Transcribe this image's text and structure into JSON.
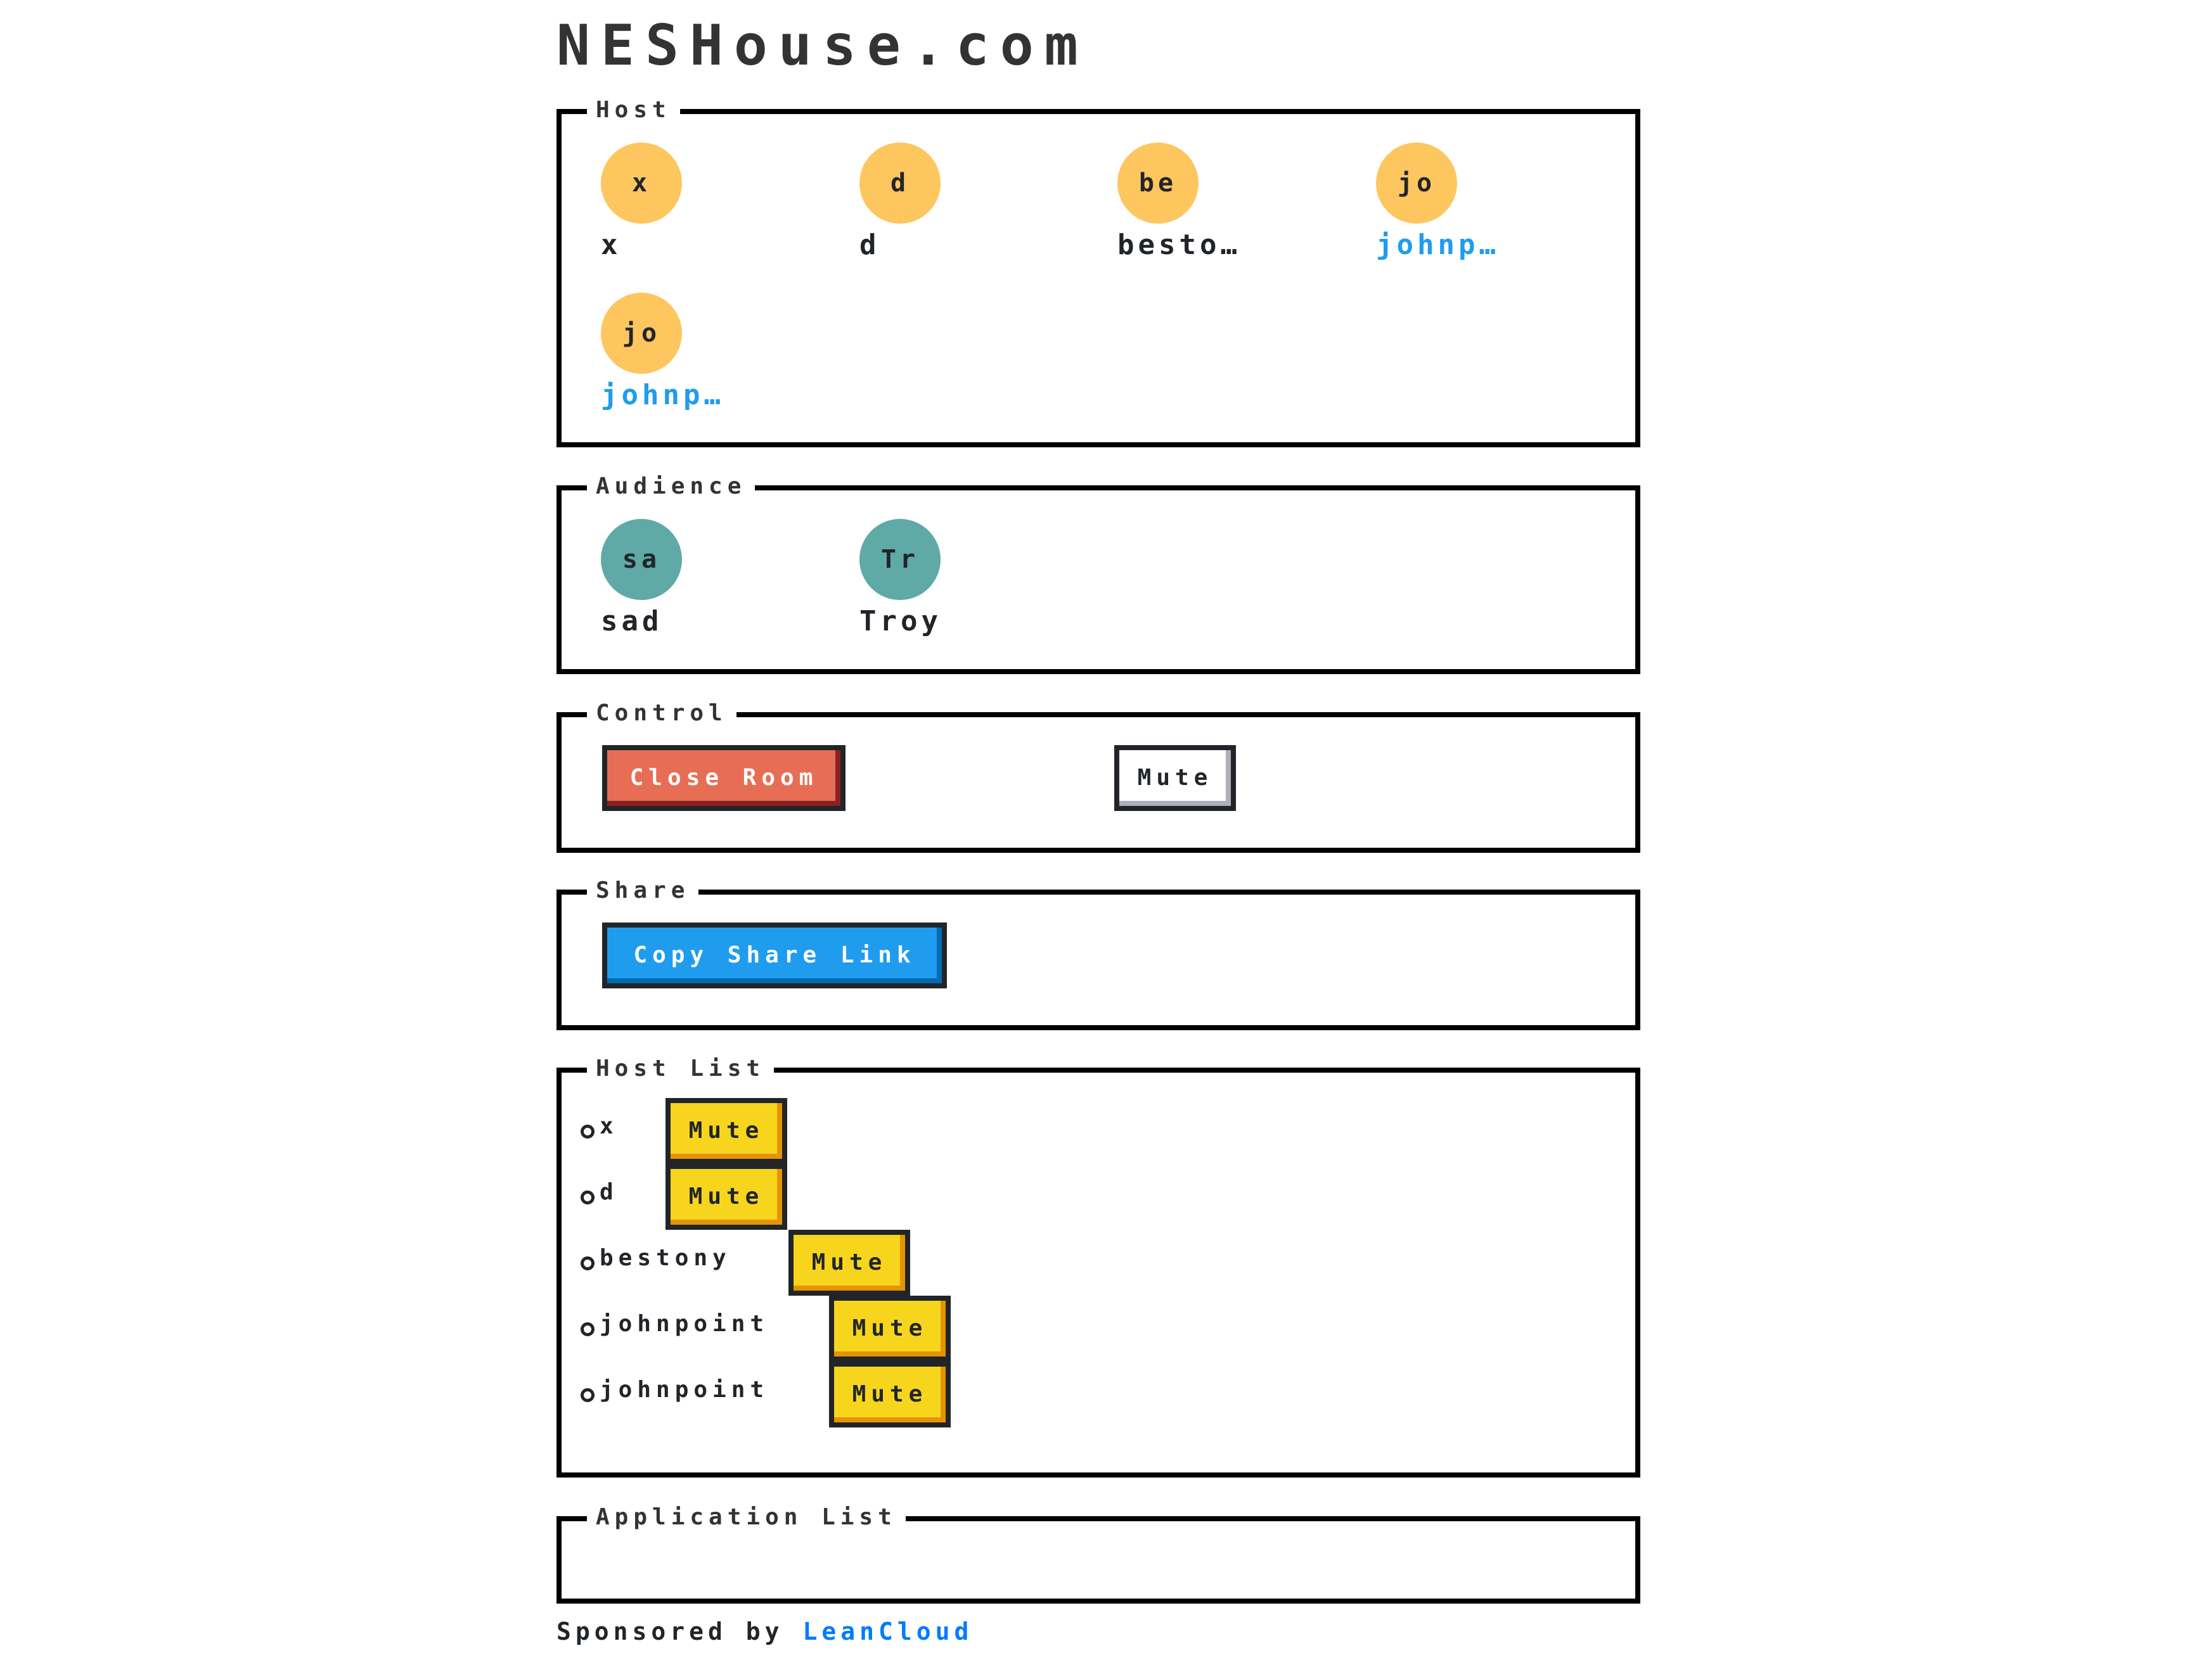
{
  "site_title": "NESHouse.com",
  "host_section": {
    "label": "Host",
    "members": [
      {
        "initials": "x",
        "name": "x",
        "is_link": false
      },
      {
        "initials": "d",
        "name": "d",
        "is_link": false
      },
      {
        "initials": "be",
        "name": "besto…",
        "is_link": false
      },
      {
        "initials": "jo",
        "name": "johnp…",
        "is_link": true
      },
      {
        "initials": "jo",
        "name": "johnp…",
        "is_link": true
      }
    ]
  },
  "audience_section": {
    "label": "Audience",
    "members": [
      {
        "initials": "sa",
        "name": "sad"
      },
      {
        "initials": "Tr",
        "name": "Troy"
      }
    ]
  },
  "control_section": {
    "label": "Control",
    "close_room_label": "Close Room",
    "mute_label": "Mute"
  },
  "share_section": {
    "label": "Share",
    "copy_link_label": "Copy Share Link"
  },
  "host_list_section": {
    "label": "Host List",
    "items": [
      {
        "name": "x",
        "mute_label": "Mute"
      },
      {
        "name": "d",
        "mute_label": "Mute"
      },
      {
        "name": "bestony",
        "mute_label": "Mute"
      },
      {
        "name": "johnpoint",
        "mute_label": "Mute"
      },
      {
        "name": "johnpoint",
        "mute_label": "Mute"
      }
    ]
  },
  "application_list_section": {
    "label": "Application List",
    "items": []
  },
  "footer": {
    "sponsored_text": "Sponsored by",
    "sponsor_link": "LeanCloud"
  },
  "colors": {
    "host_avatar": "#fec65e",
    "audience_avatar": "#5fa9a6",
    "link": "#209cee",
    "error_button": "#e76e55",
    "primary_button": "#209cee",
    "warning_button": "#f7d51d"
  }
}
